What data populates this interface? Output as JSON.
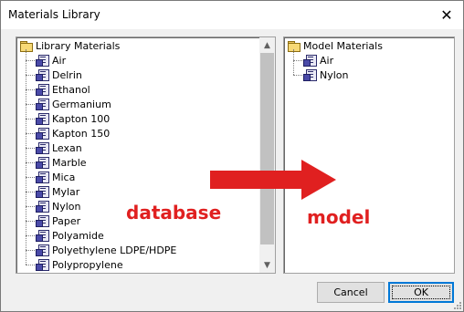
{
  "window": {
    "title": "Materials Library",
    "close_glyph": "✕"
  },
  "library": {
    "root_label": "Library Materials",
    "items": [
      "Air",
      "Delrin",
      "Ethanol",
      "Germanium",
      "Kapton 100",
      "Kapton 150",
      "Lexan",
      "Marble",
      "Mica",
      "Mylar",
      "Nylon",
      "Paper",
      "Polyamide",
      "Polyethylene LDPE/HDPE",
      "Polypropylene"
    ]
  },
  "model": {
    "root_label": "Model Materials",
    "items": [
      "Air",
      "Nylon"
    ]
  },
  "annotations": {
    "left": "database",
    "right": "model",
    "color": "#e02020"
  },
  "buttons": {
    "cancel": "Cancel",
    "ok": "OK"
  },
  "scrollbar": {
    "up_glyph": "▲",
    "down_glyph": "▼"
  }
}
